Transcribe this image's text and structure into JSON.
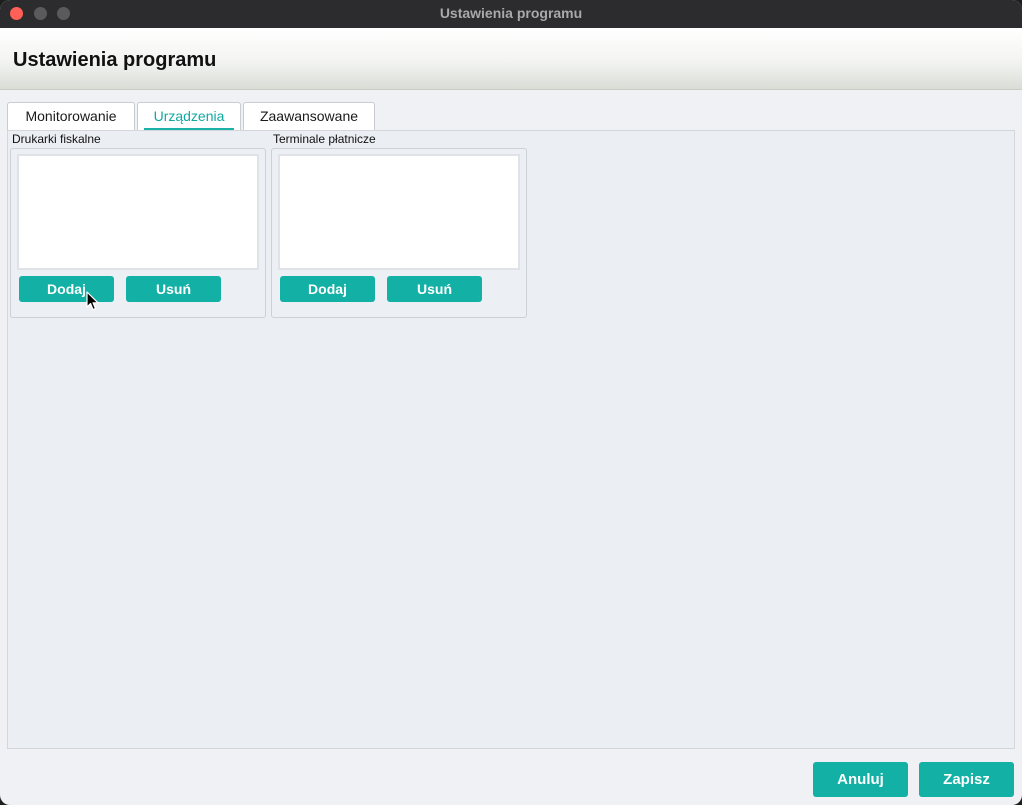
{
  "window": {
    "title": "Ustawienia programu"
  },
  "header": {
    "title": "Ustawienia programu"
  },
  "tabs": [
    {
      "label": "Monitorowanie"
    },
    {
      "label": "Urządzenia"
    },
    {
      "label": "Zaawansowane"
    }
  ],
  "active_tab": "Urządzenia",
  "groups": {
    "fiscal_printers": {
      "label": "Drukarki fiskalne",
      "add_label": "Dodaj",
      "remove_label": "Usuń"
    },
    "payment_terminals": {
      "label": "Terminale płatnicze",
      "add_label": "Dodaj",
      "remove_label": "Usuń"
    }
  },
  "footer": {
    "cancel_label": "Anuluj",
    "save_label": "Zapisz"
  },
  "colors": {
    "accent": "#13b0a5",
    "active_tab_text": "#0fa9a2",
    "titlebar": "#2c2c2e",
    "close_button": "#fe5f57"
  },
  "icons": {
    "cursor": "arrow-cursor-icon"
  }
}
